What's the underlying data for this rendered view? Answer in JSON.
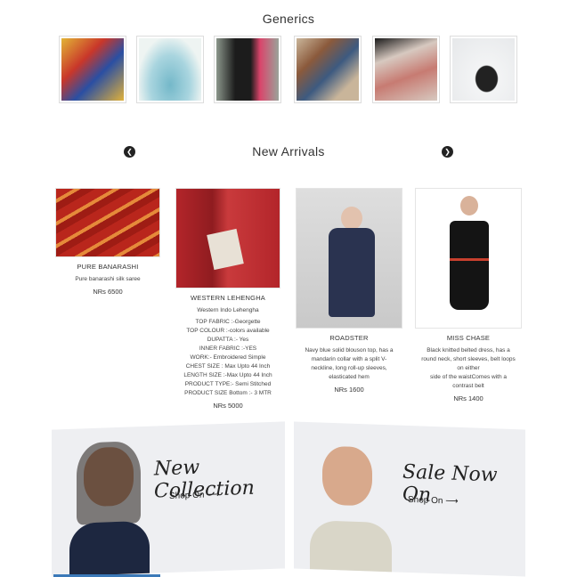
{
  "generics": {
    "title": "Generics",
    "items": [
      {
        "icon": "fabric-bundle-image",
        "bg": "#e0b13a",
        "accent": "#2a4fa3"
      },
      {
        "icon": "lehenga-image",
        "bg": "#cfe6ea",
        "accent": "#6db3c6"
      },
      {
        "icon": "gown-image",
        "bg": "#6f7a6f",
        "accent": "#d9456b"
      },
      {
        "icon": "outfit-flatlay-image",
        "bg": "#c9b59a",
        "accent": "#8b5a3c"
      },
      {
        "icon": "sandals-image",
        "bg": "#d7c9c0",
        "accent": "#c77b72"
      },
      {
        "icon": "handbag-image",
        "bg": "#e8eaec",
        "accent": "#222222"
      }
    ]
  },
  "arrivals": {
    "title": "New Arrivals",
    "prev_icon": "chevron-left-icon",
    "next_icon": "chevron-right-icon",
    "products": [
      {
        "name": "PURE BANARASHI",
        "desc": [
          "Pure banarashi silk saree"
        ],
        "price": "NRs 6500",
        "img_color": "#b9261c",
        "img_accent": "#e58a3a"
      },
      {
        "name": "WESTERN LEHENGHA",
        "desc": [
          "Western Indo Lehengha",
          "TOP FABRIC :-Georgette",
          "TOP COLOUR :-colors available",
          "DUPATTA :- Yes",
          "INNER FABRIC :-YES",
          "WORK:- Embroidered Simple",
          "CHEST SIZE : Max Upto 44 Inch",
          "LENGTH SIZE :-Max Upto 44 Inch",
          "PRODUCT TYPE:- Semi Stitched",
          "PRODUCT SIZE Bottom :- 3 MTR"
        ],
        "price": "NRs 5000",
        "img_color": "#b3252a",
        "img_accent": "#e8e1d6"
      },
      {
        "name": "ROADSTER",
        "desc": [
          "Navy blue solid blouson top, has a",
          "mandarin collar with a split V-",
          "neckline, long roll-up sleeves,",
          "elasticated hem"
        ],
        "price": "NRs 1600",
        "img_color": "#d5d5d5",
        "img_accent": "#2a3350"
      },
      {
        "name": "MISS CHASE",
        "desc": [
          "Black knitted belted dress, has a",
          "round neck, short sleeves, belt loops",
          "on either",
          "side of the waistComes with a",
          "contrast belt"
        ],
        "price": "NRs 1400",
        "img_color": "#ffffff",
        "img_accent": "#141414"
      }
    ]
  },
  "banners": [
    {
      "script_text": "New Collection",
      "shop_text": "Shop On ⟶"
    },
    {
      "script_text": "Sale Now On",
      "shop_text": "Shop On ⟶"
    }
  ]
}
